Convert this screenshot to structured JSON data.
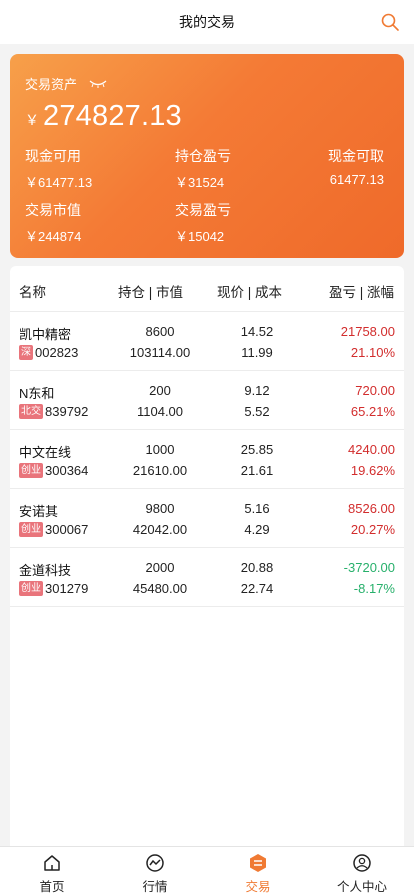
{
  "header": {
    "title": "我的交易",
    "search_icon": "search-icon",
    "accent": "#f07a33"
  },
  "asset": {
    "label": "交易资产",
    "currency": "￥",
    "total": "274827.13",
    "stats": [
      {
        "key": "现金可用",
        "value": "￥61477.13"
      },
      {
        "key": "持仓盈亏",
        "value": "￥31524"
      },
      {
        "key": "现金可取",
        "value": "61477.13"
      },
      {
        "key": "交易市值",
        "value": "￥244874"
      },
      {
        "key": "交易盈亏",
        "value": "￥15042"
      }
    ]
  },
  "table": {
    "headers": [
      "名称",
      "持仓 | 市值",
      "现价 | 成本",
      "盈亏 | 涨幅"
    ],
    "rows": [
      {
        "name": "凯中精密",
        "badge": "深",
        "code": "002823",
        "hold": "8600",
        "market_value": "103114.00",
        "price": "14.52",
        "cost": "11.99",
        "pnl": "21758.00",
        "change": "21.10%",
        "color": "red"
      },
      {
        "name": "N东和",
        "badge": "北交",
        "code": "839792",
        "hold": "200",
        "market_value": "1104.00",
        "price": "9.12",
        "cost": "5.52",
        "pnl": "720.00",
        "change": "65.21%",
        "color": "red"
      },
      {
        "name": "中文在线",
        "badge": "创业",
        "code": "300364",
        "hold": "1000",
        "market_value": "21610.00",
        "price": "25.85",
        "cost": "21.61",
        "pnl": "4240.00",
        "change": "19.62%",
        "color": "red"
      },
      {
        "name": "安诺其",
        "badge": "创业",
        "code": "300067",
        "hold": "9800",
        "market_value": "42042.00",
        "price": "5.16",
        "cost": "4.29",
        "pnl": "8526.00",
        "change": "20.27%",
        "color": "red"
      },
      {
        "name": "金道科技",
        "badge": "创业",
        "code": "301279",
        "hold": "2000",
        "market_value": "45480.00",
        "price": "20.88",
        "cost": "22.74",
        "pnl": "-3720.00",
        "change": "-8.17%",
        "color": "green"
      }
    ]
  },
  "tabs": [
    {
      "label": "首页",
      "icon": "home-icon"
    },
    {
      "label": "行情",
      "icon": "market-chart-icon"
    },
    {
      "label": "交易",
      "icon": "trade-icon",
      "active": true
    },
    {
      "label": "个人中心",
      "icon": "profile-icon"
    }
  ]
}
